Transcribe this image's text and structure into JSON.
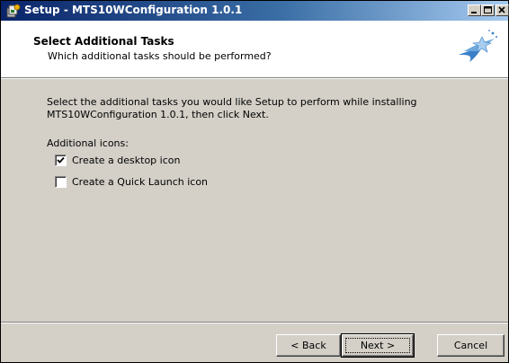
{
  "window": {
    "title": "Setup - MTS10WConfiguration 1.0.1",
    "titlebar_color": "#0a246a",
    "face_color": "#d4d0c8"
  },
  "titlebar_buttons": {
    "minimize_icon": "minimize-icon",
    "maximize_icon": "maximize-icon",
    "close_icon": "close-icon"
  },
  "header": {
    "title": "Select Additional Tasks",
    "subtitle": "Which additional tasks should be performed?",
    "logo_icon": "setup-wizard-icon"
  },
  "content": {
    "intro": "Select the additional tasks you would like Setup to perform while installing MTS10WConfiguration 1.0.1, then click Next.",
    "section_label": "Additional icons:",
    "tasks": [
      {
        "label": "Create a desktop icon",
        "checked": true
      },
      {
        "label": "Create a Quick Launch icon",
        "checked": false
      }
    ]
  },
  "buttons": {
    "back": "< Back",
    "next": "Next >",
    "cancel": "Cancel"
  }
}
